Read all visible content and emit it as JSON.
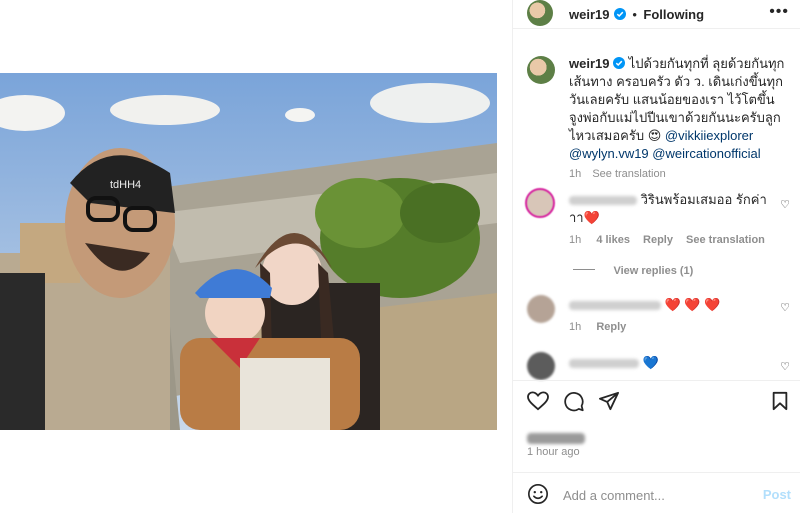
{
  "header": {
    "username": "weir19",
    "separator": "•",
    "follow_label": "Following",
    "more": "•••"
  },
  "caption": {
    "username": "weir19",
    "text": "ไปด้วยกันทุกที่ ลุยด้วยกันทุกเส้นทาง ครอบครัว ดัว ว. เดินเก่งขึ้นทุกวันเลยครับ แสนน้อยของเรา ไว้โตขึ้น จูงพ่อกับแม่ไปปีนเขาด้วยกันนะครับลูก ไหวเสมอครับ",
    "emoji": "😍",
    "mention1": "@vikkiiexplorer",
    "mention2": "@wylyn.vw19",
    "mention3": "@weircationofficial",
    "time": "1h",
    "see_translation": "See translation"
  },
  "comments": [
    {
      "text": "วิรินพร้อมเสมออ รักค่าาา",
      "emoji": "❤️",
      "time": "1h",
      "likes": "4 likes",
      "reply": "Reply",
      "see_translation": "See translation"
    },
    {
      "view_replies": "View replies (1)"
    },
    {
      "emoji": "❤️ ❤️ ❤️",
      "time": "1h",
      "reply": "Reply"
    },
    {
      "emoji": "💙"
    }
  ],
  "footer": {
    "time_ago": "1 hour ago",
    "comment_placeholder": "Add a comment...",
    "post_label": "Post"
  },
  "colors": {
    "verified": "#0095f6",
    "link": "#00376b",
    "muted": "#8e8e8e",
    "post": "#b2dffc"
  }
}
